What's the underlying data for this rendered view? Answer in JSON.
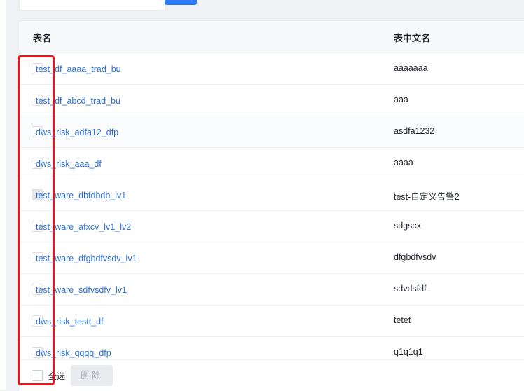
{
  "table": {
    "headers": {
      "name": "表名",
      "cn_name": "表中文名"
    },
    "rows": [
      {
        "name": "test_df_aaaa_trad_bu",
        "cn_name": "aaaaaaa"
      },
      {
        "name": "test_df_abcd_trad_bu",
        "cn_name": "aaa"
      },
      {
        "name": "dws_risk_adfa12_dfp",
        "cn_name": "asdfa1232"
      },
      {
        "name": "dws_risk_aaa_df",
        "cn_name": "aaaa"
      },
      {
        "name": "test_ware_dbfdbdb_lv1",
        "cn_name": "test-自定义告警2"
      },
      {
        "name": "test_ware_afxcv_lv1_lv2",
        "cn_name": "sdgscx"
      },
      {
        "name": "test_ware_dfgbdfvsdv_lv1",
        "cn_name": "dfgbdfvsdv"
      },
      {
        "name": "test_ware_sdfvsdfv_lv1",
        "cn_name": "sdvdsfdf"
      },
      {
        "name": "dws_risk_testt_df",
        "cn_name": "tetet"
      },
      {
        "name": "dws_risk_qqqq_dfp",
        "cn_name": "q1q1q1"
      }
    ]
  },
  "footer": {
    "select_all_label": "全选",
    "delete_label": "删除"
  },
  "colors": {
    "link": "#2b6fd6",
    "highlight": "#e4171c",
    "primary": "#2f7cf6"
  }
}
